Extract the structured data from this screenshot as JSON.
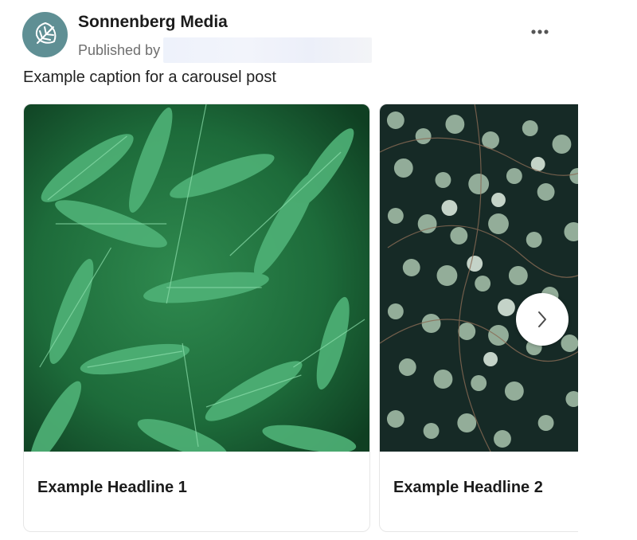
{
  "post": {
    "author": {
      "name": "Sonnenberg Media",
      "avatar_icon": "leaf-logo-icon",
      "avatar_color": "#5f8f94",
      "published_label": "Published by"
    },
    "more_icon": "more-horizontal-icon",
    "caption": "Example caption for a carousel post",
    "carousel": {
      "cards": [
        {
          "headline": "Example Headline 1",
          "image": "green-fern-leaves-photo"
        },
        {
          "headline": "Example Headline 2",
          "image": "round-leaf-plant-photo"
        }
      ],
      "next_icon": "chevron-right-icon"
    }
  }
}
